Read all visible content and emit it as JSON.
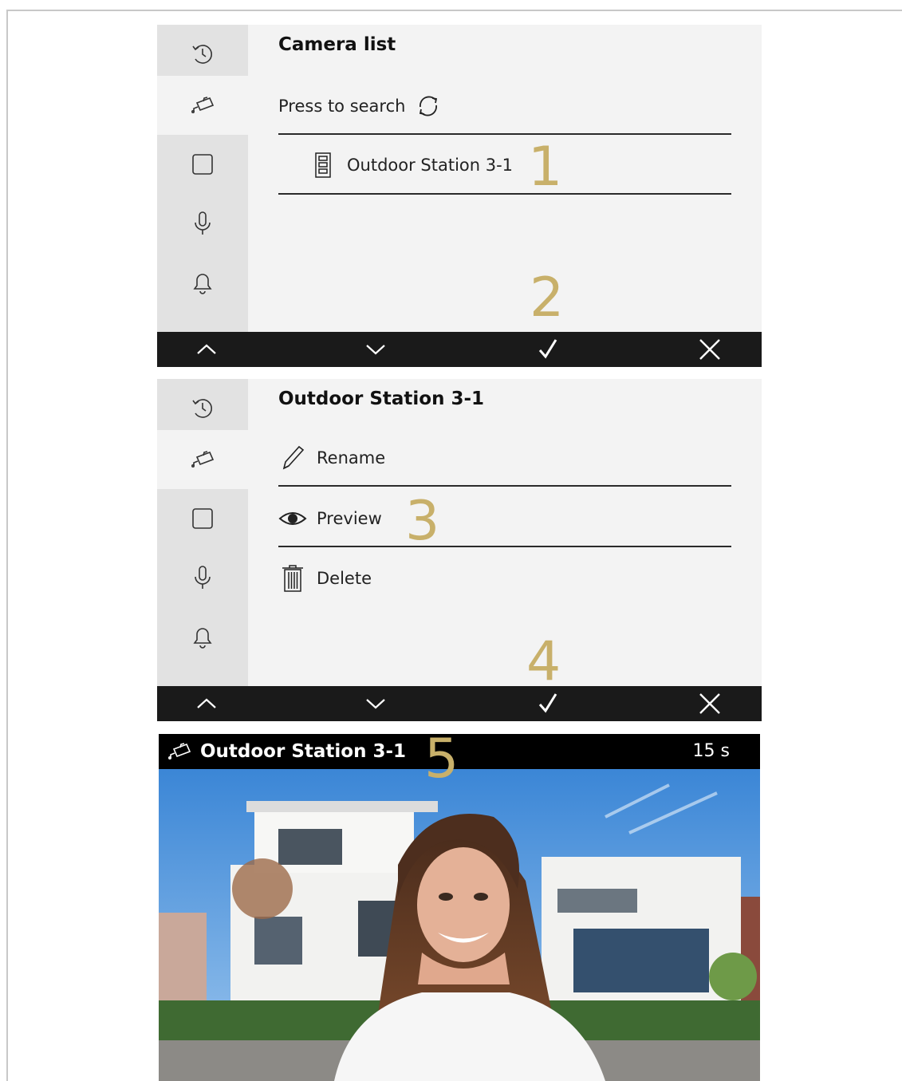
{
  "screen1": {
    "title": "Camera list",
    "search_label": "Press to search",
    "item_label": "Outdoor Station 3-1",
    "callout_1": "1",
    "callout_2": "2"
  },
  "screen2": {
    "title": "Outdoor Station 3-1",
    "rename_label": "Rename",
    "preview_label": "Preview",
    "delete_label": "Delete",
    "callout_3": "3",
    "callout_4": "4"
  },
  "screen3": {
    "title": "Outdoor Station 3-1",
    "timer": "15 s",
    "callout_5": "5"
  },
  "sidebar_icons": [
    "history-icon",
    "camera-icon",
    "square-icon",
    "microphone-icon",
    "bell-icon"
  ],
  "bottombar_icons": [
    "chevron-up-icon",
    "chevron-down-icon",
    "check-icon",
    "close-icon"
  ],
  "colors": {
    "callout": "#c8b06a",
    "bar": "#1a1a1a",
    "sidebar": "#e2e2e2",
    "panel": "#f3f3f3"
  }
}
